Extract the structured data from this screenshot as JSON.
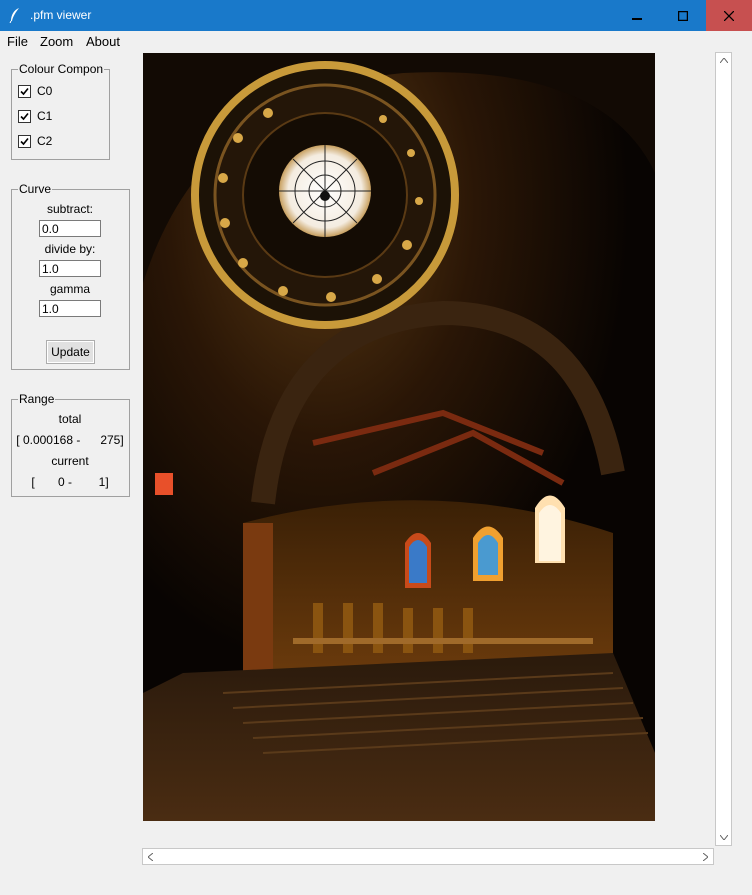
{
  "window": {
    "title": ".pfm viewer"
  },
  "menu": {
    "file": "File",
    "zoom": "Zoom",
    "about": "About"
  },
  "colour_group": {
    "legend": "Colour Compon",
    "channels": [
      {
        "label": "C0",
        "checked": true
      },
      {
        "label": "C1",
        "checked": true
      },
      {
        "label": "C2",
        "checked": true
      }
    ]
  },
  "curve_group": {
    "legend": "Curve",
    "subtract_label": "subtract:",
    "subtract_value": "0.0",
    "divide_label": "divide by:",
    "divide_value": "1.0",
    "gamma_label": "gamma",
    "gamma_value": "1.0",
    "update_button": "Update"
  },
  "range_group": {
    "legend": "Range",
    "total_label": "total",
    "total_value": "[ 0.000168 -      275]",
    "current_label": "current",
    "current_value": "[       0 -        1]"
  },
  "image": {
    "description_icon": "hdr-image"
  },
  "colors": {
    "titlebar": "#1979ca",
    "close": "#c75050",
    "background": "#f0f0f0"
  }
}
